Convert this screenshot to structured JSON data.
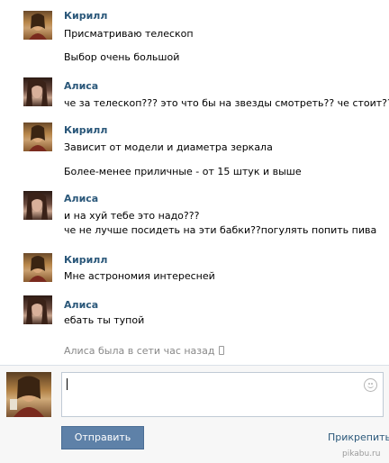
{
  "messages": [
    {
      "author": "Кирилл",
      "lines": [
        "Присматриваю телескоп",
        "Выбор очень большой"
      ]
    },
    {
      "author": "Алиса",
      "lines": [
        "че за телескоп??? это что бы на звезды смотреть?? че стоит??"
      ]
    },
    {
      "author": "Кирилл",
      "lines": [
        "Зависит от модели и диаметра зеркала",
        "Более-менее приличные - от 15 штук и выше"
      ]
    },
    {
      "author": "Алиса",
      "lines": [
        "и на хуй тебе это надо???",
        "че не лучше посидеть на эти бабки??погулять попить пива"
      ]
    },
    {
      "author": "Кирилл",
      "lines": [
        "Мне астрономия интересней"
      ]
    },
    {
      "author": "Алиса",
      "lines": [
        "ебать ты тупой"
      ]
    }
  ],
  "status": {
    "text": "Алиса была в сети час назад",
    "icon": "mobile-phone-icon"
  },
  "composer": {
    "input_value": "",
    "send_label": "Отправить",
    "attach_label": "Прикрепить",
    "smile_icon": "smile-icon"
  },
  "watermark": "pikabu.ru",
  "colors": {
    "author": "#2b587a",
    "button": "#5e81a8",
    "status": "#888888"
  }
}
